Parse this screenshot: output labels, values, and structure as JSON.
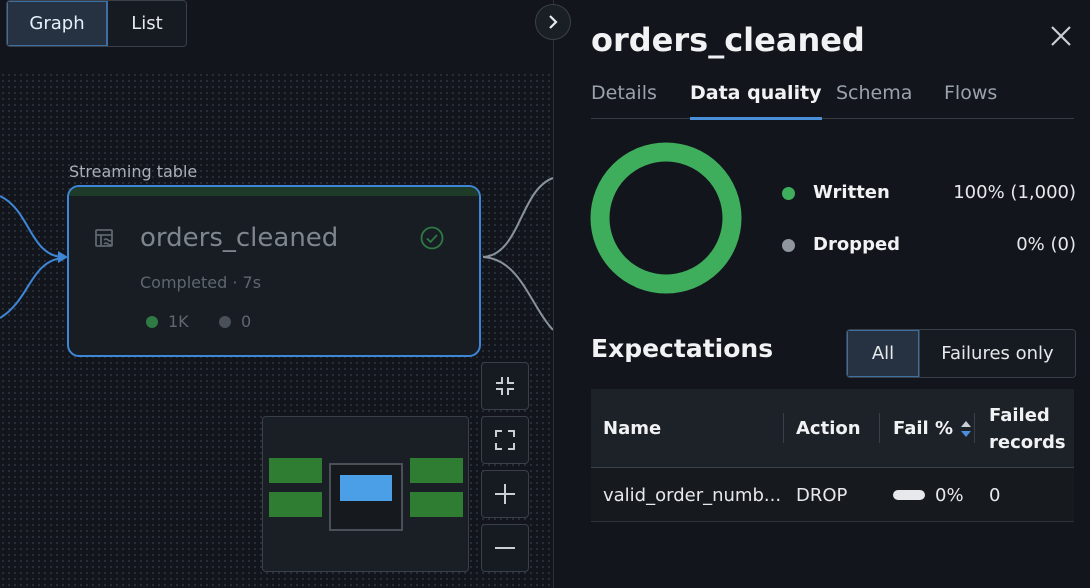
{
  "view_toggle": {
    "graph_label": "Graph",
    "list_label": "List"
  },
  "node": {
    "kind": "Streaming table",
    "title": "orders_cleaned",
    "status": "Completed · 7s",
    "written_count": "1K",
    "dropped_count": "0"
  },
  "panel": {
    "title": "orders_cleaned",
    "tabs": [
      "Details",
      "Data quality",
      "Schema",
      "Flows"
    ],
    "active_tab": "Data quality",
    "quality": {
      "written": {
        "label": "Written",
        "value": "100% (1,000)",
        "color": "#3fae5c"
      },
      "dropped": {
        "label": "Dropped",
        "value": "0% (0)",
        "color": "#8f969e"
      }
    },
    "expectations": {
      "title": "Expectations",
      "filter_all": "All",
      "filter_failures": "Failures only",
      "columns": {
        "name": "Name",
        "action": "Action",
        "fail_pct": "Fail %",
        "failed_records": "Failed records"
      },
      "rows": [
        {
          "name": "valid_order_numb...",
          "action": "DROP",
          "fail_pct": "0%",
          "failed_records": "0"
        }
      ]
    }
  },
  "colors": {
    "accent": "#4a90d9",
    "success": "#3fae5c",
    "node_border": "#3f86d6"
  },
  "icons": [
    "chevron-right-icon",
    "close-icon",
    "table-icon",
    "check-circle-icon",
    "collapse-icon",
    "fit-view-icon",
    "zoom-in-icon",
    "zoom-out-icon",
    "sort-icon"
  ]
}
